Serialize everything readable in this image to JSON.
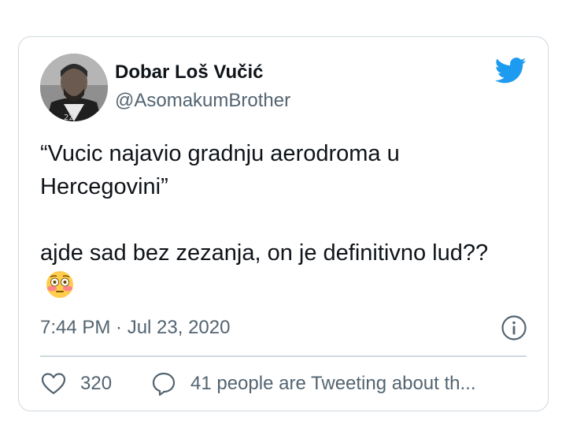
{
  "tweet": {
    "display_name": "Dobar Loš Vučić",
    "handle": "@AsomakumBrother",
    "text_line1": "“Vucic najavio gradnju aerodroma u Hercegovini”",
    "text_line2": "ajde sad bez zezanja, on je definitivno lud??",
    "emoji": "flushed-face",
    "timestamp": "7:44 PM · Jul 23, 2020",
    "like_count": "320",
    "reply_label": "41 people are Tweeting about th..."
  },
  "colors": {
    "twitter_blue": "#1d9bf0",
    "text": "#0f1419",
    "secondary": "#536471",
    "border": "#cfd9de"
  }
}
